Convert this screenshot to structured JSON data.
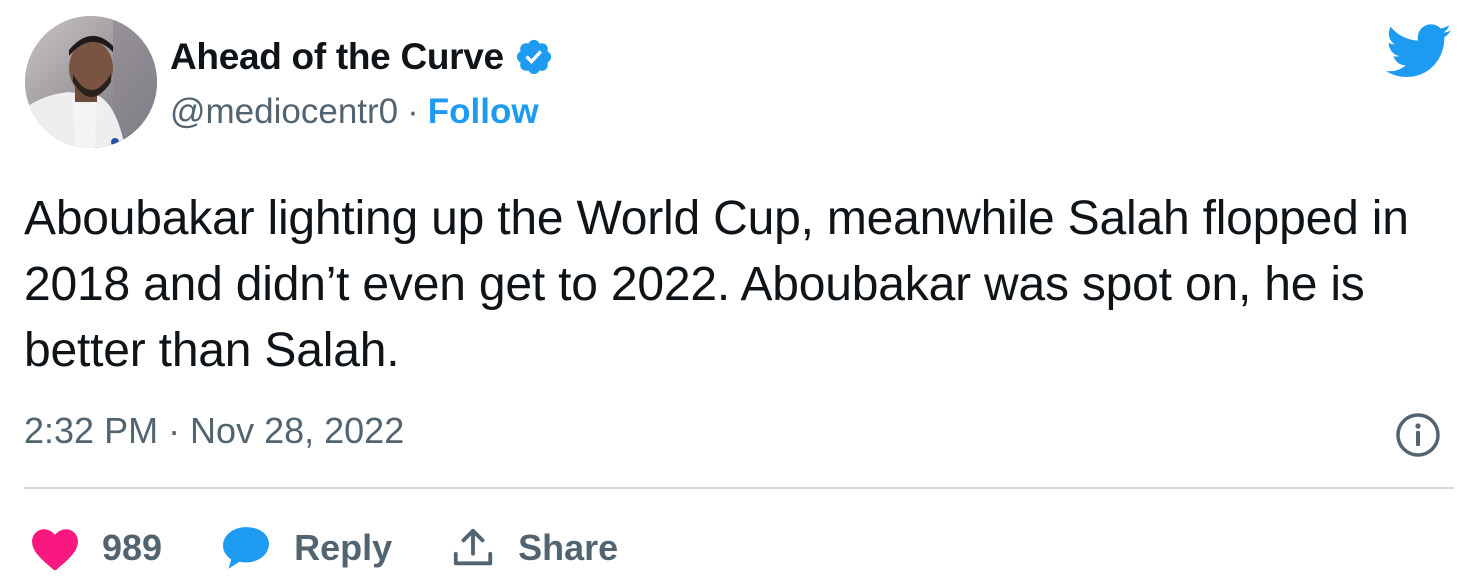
{
  "author": {
    "display_name": "Ahead of the Curve",
    "handle": "@mediocentr0",
    "separator": "·",
    "follow_label": "Follow"
  },
  "tweet": {
    "text": "Aboubakar lighting up the World Cup, meanwhile Salah flopped in 2018 and didn’t even get to 2022. Aboubakar was spot on, he is better than Salah.",
    "timestamp": "2:32 PM · Nov 28, 2022"
  },
  "actions": {
    "like_count": "989",
    "reply_label": "Reply",
    "share_label": "Share"
  },
  "icons": {
    "logo": "twitter-bird-icon",
    "verified": "verified-badge-icon",
    "info": "info-icon",
    "like": "heart-icon",
    "reply": "speech-bubble-icon",
    "share": "share-icon"
  },
  "colors": {
    "accent": "#1d9bf0",
    "like": "#f91880",
    "text": "#0f1419",
    "secondary": "#536471",
    "divider": "#cfd9de"
  }
}
